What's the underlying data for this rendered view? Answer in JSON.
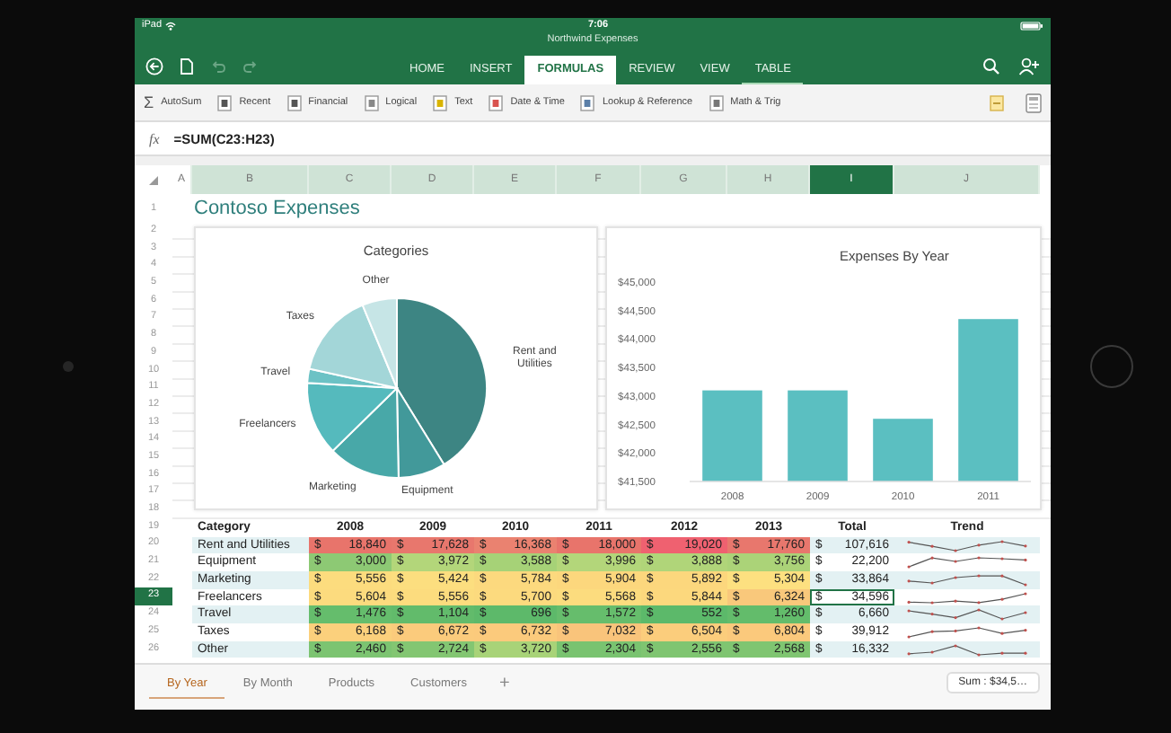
{
  "status_bar": {
    "device": "iPad",
    "time": "7:06"
  },
  "document_title": "Northwind Expenses",
  "ribbon_tabs": [
    {
      "label": "HOME",
      "selected": false,
      "contextual": false
    },
    {
      "label": "INSERT",
      "selected": false,
      "contextual": false
    },
    {
      "label": "FORMULAS",
      "selected": true,
      "contextual": false
    },
    {
      "label": "REVIEW",
      "selected": false,
      "contextual": false
    },
    {
      "label": "VIEW",
      "selected": false,
      "contextual": false
    },
    {
      "label": "TABLE",
      "selected": false,
      "contextual": true
    }
  ],
  "toolbar": [
    {
      "kind": "glyph",
      "symbol": "Σ",
      "label": "AutoSum"
    },
    {
      "kind": "category",
      "label": "Recent"
    },
    {
      "kind": "category",
      "label": "Financial"
    },
    {
      "kind": "category",
      "label": "Logical"
    },
    {
      "kind": "category",
      "label": "Text"
    },
    {
      "kind": "category",
      "label": "Date & Time"
    },
    {
      "kind": "category",
      "label": "Lookup & Reference"
    },
    {
      "kind": "category",
      "label": "Math & Trig"
    }
  ],
  "formula_bar": {
    "label": "fx",
    "value": "=SUM(C23:H23)"
  },
  "columns": [
    {
      "letter": "A",
      "selected": false
    },
    {
      "letter": "B",
      "selected": false
    },
    {
      "letter": "C",
      "selected": false
    },
    {
      "letter": "D",
      "selected": false
    },
    {
      "letter": "E",
      "selected": false
    },
    {
      "letter": "F",
      "selected": false
    },
    {
      "letter": "G",
      "selected": false
    },
    {
      "letter": "H",
      "selected": false
    },
    {
      "letter": "I",
      "selected": true
    },
    {
      "letter": "J",
      "selected": false
    }
  ],
  "row_headers": [
    {
      "number": "1",
      "selected": false
    },
    {
      "number": "2",
      "selected": false
    },
    {
      "number": "3",
      "selected": false
    },
    {
      "number": "4",
      "selected": false
    },
    {
      "number": "5",
      "selected": false
    },
    {
      "number": "6",
      "selected": false
    },
    {
      "number": "7",
      "selected": false
    },
    {
      "number": "8",
      "selected": false
    },
    {
      "number": "9",
      "selected": false
    },
    {
      "number": "10",
      "selected": false
    },
    {
      "number": "11",
      "selected": false
    },
    {
      "number": "12",
      "selected": false
    },
    {
      "number": "13",
      "selected": false
    },
    {
      "number": "14",
      "selected": false
    },
    {
      "number": "15",
      "selected": false
    },
    {
      "number": "16",
      "selected": false
    },
    {
      "number": "17",
      "selected": false
    },
    {
      "number": "18",
      "selected": false
    },
    {
      "number": "19",
      "selected": false
    },
    {
      "number": "20",
      "selected": false
    },
    {
      "number": "21",
      "selected": false
    },
    {
      "number": "22",
      "selected": false
    },
    {
      "number": "23",
      "selected": true
    },
    {
      "number": "24",
      "selected": false
    },
    {
      "number": "25",
      "selected": false
    },
    {
      "number": "26",
      "selected": false
    }
  ],
  "sheet_title": "Contoso Expenses",
  "pie_chart": {
    "title": "Categories",
    "slices": [
      {
        "label": "Rent and Utilities",
        "color": "#3d8583"
      },
      {
        "label": "Equipment",
        "color": "#42999a"
      },
      {
        "label": "Marketing",
        "color": "#48a8a8"
      },
      {
        "label": "Freelancers",
        "color": "#55babd"
      },
      {
        "label": "Travel",
        "color": "#6cc2c5"
      },
      {
        "label": "Taxes",
        "color": "#a3d6d8"
      },
      {
        "label": "Other",
        "color": "#c6e5e6"
      }
    ]
  },
  "bar_chart": {
    "chart_data": {
      "type": "bar",
      "title": "Expenses By Year",
      "categories": [
        "2008",
        "2009",
        "2010",
        "2011"
      ],
      "values": [
        43100,
        43100,
        42600,
        44350
      ],
      "ylim": [
        41500,
        45000
      ],
      "yticks": [
        {
          "value": 41500,
          "label": "$41,500"
        },
        {
          "value": 42000,
          "label": "$42,000"
        },
        {
          "value": 42500,
          "label": "$42,500"
        },
        {
          "value": 43000,
          "label": "$43,000"
        },
        {
          "value": 43500,
          "label": "$43,500"
        },
        {
          "value": 44000,
          "label": "$44,000"
        },
        {
          "value": 44500,
          "label": "$44,500"
        },
        {
          "value": 45000,
          "label": "$45,000"
        }
      ]
    }
  },
  "table": {
    "columns": [
      "Category",
      "2008",
      "2009",
      "2010",
      "2011",
      "2012",
      "2013",
      "Total",
      "Trend"
    ],
    "rows": [
      {
        "cells": [
          {
            "kind": "label",
            "text": "Rent and Utilities"
          },
          {
            "kind": "money",
            "text": "$ 18,840",
            "color": "#e8746b"
          },
          {
            "kind": "money",
            "text": "$ 17,628",
            "color": "#e8776d"
          },
          {
            "kind": "money",
            "text": "$ 16,368",
            "color": "#ea8270"
          },
          {
            "kind": "money",
            "text": "$ 18,000",
            "color": "#e8746b"
          },
          {
            "kind": "money",
            "text": "$ 19,020",
            "color": "#ef6170"
          },
          {
            "kind": "money",
            "text": "$ 17,760",
            "color": "#e8776d"
          },
          {
            "kind": "total",
            "text": "$ 107,616",
            "selected": false
          }
        ]
      },
      {
        "cells": [
          {
            "kind": "label",
            "text": "Equipment"
          },
          {
            "kind": "money",
            "text": "$ 3,000",
            "color": "#8dc974"
          },
          {
            "kind": "money",
            "text": "$ 3,972",
            "color": "#b3d67a"
          },
          {
            "kind": "money",
            "text": "$ 3,588",
            "color": "#a6d277"
          },
          {
            "kind": "money",
            "text": "$ 3,996",
            "color": "#b3d67a"
          },
          {
            "kind": "money",
            "text": "$ 3,888",
            "color": "#b0d579"
          },
          {
            "kind": "money",
            "text": "$ 3,756",
            "color": "#abd378"
          },
          {
            "kind": "total",
            "text": "$ 22,200",
            "selected": false
          }
        ]
      },
      {
        "cells": [
          {
            "kind": "label",
            "text": "Marketing"
          },
          {
            "kind": "money",
            "text": "$ 5,556",
            "color": "#fcdc7e"
          },
          {
            "kind": "money",
            "text": "$ 5,424",
            "color": "#fcde7f"
          },
          {
            "kind": "money",
            "text": "$ 5,784",
            "color": "#fcd97e"
          },
          {
            "kind": "money",
            "text": "$ 5,904",
            "color": "#fcd77d"
          },
          {
            "kind": "money",
            "text": "$ 5,892",
            "color": "#fcd77d"
          },
          {
            "kind": "money",
            "text": "$ 5,304",
            "color": "#fde080"
          },
          {
            "kind": "total",
            "text": "$ 33,864",
            "selected": false
          }
        ]
      },
      {
        "cells": [
          {
            "kind": "label",
            "text": "Freelancers"
          },
          {
            "kind": "money",
            "text": "$ 5,604",
            "color": "#fcdb7e"
          },
          {
            "kind": "money",
            "text": "$ 5,556",
            "color": "#fcdc7e"
          },
          {
            "kind": "money",
            "text": "$ 5,700",
            "color": "#fcda7e"
          },
          {
            "kind": "money",
            "text": "$ 5,568",
            "color": "#fcdc7e"
          },
          {
            "kind": "money",
            "text": "$ 5,844",
            "color": "#fcd87d"
          },
          {
            "kind": "money",
            "text": "$ 6,324",
            "color": "#f9c87b"
          },
          {
            "kind": "total",
            "text": "$ 34,596",
            "selected": true
          }
        ]
      },
      {
        "cells": [
          {
            "kind": "label",
            "text": "Travel"
          },
          {
            "kind": "money",
            "text": "$ 1,476",
            "color": "#65bd6c"
          },
          {
            "kind": "money",
            "text": "$ 1,104",
            "color": "#62bb6b"
          },
          {
            "kind": "money",
            "text": "$ 696",
            "color": "#5db96a"
          },
          {
            "kind": "money",
            "text": "$ 1,572",
            "color": "#66bd6c"
          },
          {
            "kind": "money",
            "text": "$ 552",
            "color": "#5cb96a"
          },
          {
            "kind": "money",
            "text": "$ 1,260",
            "color": "#63bc6b"
          },
          {
            "kind": "total",
            "text": "$ 6,660",
            "selected": false
          }
        ]
      },
      {
        "cells": [
          {
            "kind": "label",
            "text": "Taxes"
          },
          {
            "kind": "money",
            "text": "$ 6,168",
            "color": "#fbd07c"
          },
          {
            "kind": "money",
            "text": "$ 6,672",
            "color": "#fbcb7c"
          },
          {
            "kind": "money",
            "text": "$ 6,732",
            "color": "#fbca7c"
          },
          {
            "kind": "money",
            "text": "$ 7,032",
            "color": "#f9c47b"
          },
          {
            "kind": "money",
            "text": "$ 6,504",
            "color": "#fbcd7c"
          },
          {
            "kind": "money",
            "text": "$ 6,804",
            "color": "#fbc97c"
          },
          {
            "kind": "total",
            "text": "$ 39,912",
            "selected": false
          }
        ]
      },
      {
        "cells": [
          {
            "kind": "label",
            "text": "Other"
          },
          {
            "kind": "money",
            "text": "$ 2,460",
            "color": "#7cc471"
          },
          {
            "kind": "money",
            "text": "$ 2,724",
            "color": "#83c672"
          },
          {
            "kind": "money",
            "text": "$ 3,720",
            "color": "#a8d378"
          },
          {
            "kind": "money",
            "text": "$ 2,304",
            "color": "#79c370"
          },
          {
            "kind": "money",
            "text": "$ 2,556",
            "color": "#7fc571"
          },
          {
            "kind": "money",
            "text": "$ 2,568",
            "color": "#7fc571"
          },
          {
            "kind": "total",
            "text": "$ 16,332",
            "selected": false
          }
        ]
      }
    ]
  },
  "sheet_tabs": [
    {
      "label": "By Year",
      "selected": true
    },
    {
      "label": "By Month",
      "selected": false
    },
    {
      "label": "Products",
      "selected": false
    },
    {
      "label": "Customers",
      "selected": false
    }
  ],
  "add_sheet": "+",
  "sum": "Sum : $34,5…"
}
